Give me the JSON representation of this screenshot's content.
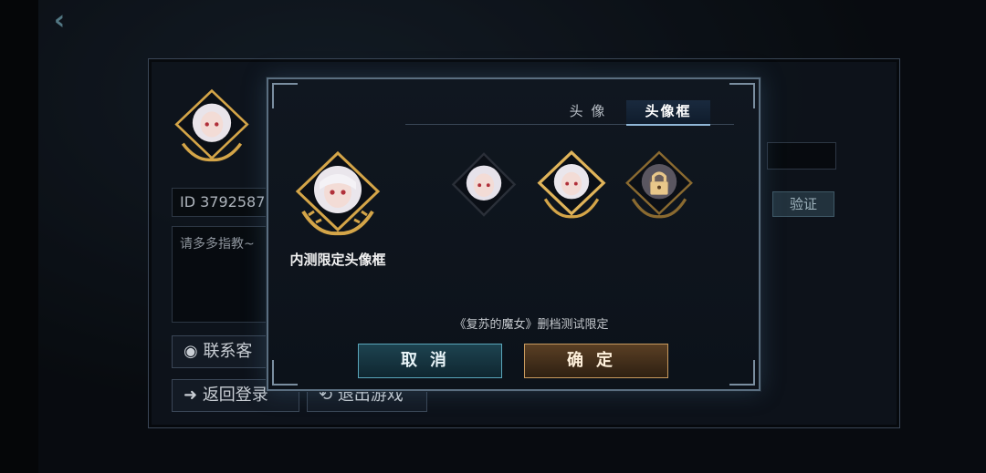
{
  "nav": {
    "back_icon": "back-chevron-icon"
  },
  "profile": {
    "id_label": "ID  3792587",
    "signature": "请多多指教~",
    "contact_label": "联系客",
    "return_login_label": "返回登录",
    "exit_game_label": "退出游戏",
    "verify_label": "验证"
  },
  "dialog": {
    "tabs": [
      {
        "label": "头 像",
        "active": false
      },
      {
        "label": "头像框",
        "active": true
      }
    ],
    "preview_label": "内测限定头像框",
    "frames": [
      {
        "name": "no-frame",
        "locked": false,
        "selected": false
      },
      {
        "name": "gold-laurel-frame",
        "locked": false,
        "selected": true
      },
      {
        "name": "locked-frame",
        "locked": true,
        "selected": false
      }
    ],
    "note": "《复苏的魔女》删档测试限定",
    "cancel_label": "取消",
    "confirm_label": "确定"
  },
  "colors": {
    "accent_cyan": "#5aa6bb",
    "accent_gold": "#c89a5e",
    "frame_gold": "#d4a548"
  }
}
